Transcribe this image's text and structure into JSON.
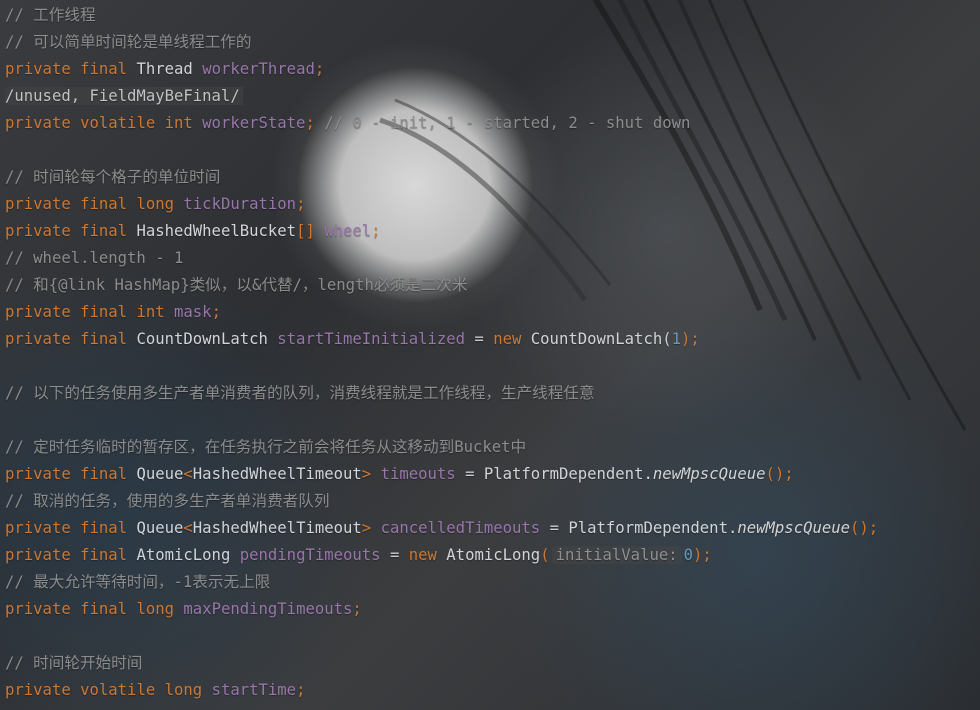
{
  "code_lines": [
    {
      "kind": "line",
      "tokens": [
        {
          "text": "// 工作线程",
          "cls": "cm"
        }
      ]
    },
    {
      "kind": "line",
      "tokens": [
        {
          "text": "// 可以简单时间轮是单线程工作的",
          "cls": "cm"
        }
      ]
    },
    {
      "kind": "line",
      "tokens": [
        {
          "text": "private",
          "cls": "kw"
        },
        {
          "text": " ",
          "cls": "plain"
        },
        {
          "text": "final",
          "cls": "kw"
        },
        {
          "text": " ",
          "cls": "plain"
        },
        {
          "text": "Thread",
          "cls": "ty"
        },
        {
          "text": " ",
          "cls": "plain"
        },
        {
          "text": "workerThread",
          "cls": "fld"
        },
        {
          "text": ";",
          "cls": "kw"
        }
      ]
    },
    {
      "kind": "line",
      "tokens": [
        {
          "text": "/unused, FieldMayBeFinal/",
          "cls": "suppress"
        }
      ]
    },
    {
      "kind": "line",
      "tokens": [
        {
          "text": "private",
          "cls": "kw"
        },
        {
          "text": " ",
          "cls": "plain"
        },
        {
          "text": "volatile",
          "cls": "kw"
        },
        {
          "text": " ",
          "cls": "plain"
        },
        {
          "text": "int",
          "cls": "kw"
        },
        {
          "text": " ",
          "cls": "plain"
        },
        {
          "text": "workerState",
          "cls": "fld"
        },
        {
          "text": "; ",
          "cls": "kw"
        },
        {
          "text": "// 0 - init, 1 - started, 2 - shut down",
          "cls": "cm"
        }
      ]
    },
    {
      "kind": "blank"
    },
    {
      "kind": "line",
      "tokens": [
        {
          "text": "// 时间轮每个格子的单位时间",
          "cls": "cm"
        }
      ]
    },
    {
      "kind": "line",
      "tokens": [
        {
          "text": "private",
          "cls": "kw"
        },
        {
          "text": " ",
          "cls": "plain"
        },
        {
          "text": "final",
          "cls": "kw"
        },
        {
          "text": " ",
          "cls": "plain"
        },
        {
          "text": "long",
          "cls": "kw"
        },
        {
          "text": " ",
          "cls": "plain"
        },
        {
          "text": "tickDuration",
          "cls": "fld"
        },
        {
          "text": ";",
          "cls": "kw"
        }
      ]
    },
    {
      "kind": "line",
      "tokens": [
        {
          "text": "private",
          "cls": "kw"
        },
        {
          "text": " ",
          "cls": "plain"
        },
        {
          "text": "final",
          "cls": "kw"
        },
        {
          "text": " ",
          "cls": "plain"
        },
        {
          "text": "HashedWheelBucket",
          "cls": "ty"
        },
        {
          "text": "[]",
          "cls": "kw"
        },
        {
          "text": " ",
          "cls": "plain"
        },
        {
          "text": "wheel",
          "cls": "fld"
        },
        {
          "text": ";",
          "cls": "kw"
        }
      ]
    },
    {
      "kind": "line",
      "tokens": [
        {
          "text": "// wheel.length - 1",
          "cls": "cm"
        }
      ]
    },
    {
      "kind": "line",
      "tokens": [
        {
          "text": "// 和{@link HashMap}类似，以&代替/，length必须是二次米",
          "cls": "cm"
        }
      ]
    },
    {
      "kind": "line",
      "tokens": [
        {
          "text": "private",
          "cls": "kw"
        },
        {
          "text": " ",
          "cls": "plain"
        },
        {
          "text": "final",
          "cls": "kw"
        },
        {
          "text": " ",
          "cls": "plain"
        },
        {
          "text": "int",
          "cls": "kw"
        },
        {
          "text": " ",
          "cls": "plain"
        },
        {
          "text": "mask",
          "cls": "fld"
        },
        {
          "text": ";",
          "cls": "kw"
        }
      ]
    },
    {
      "kind": "line",
      "tokens": [
        {
          "text": "private",
          "cls": "kw"
        },
        {
          "text": " ",
          "cls": "plain"
        },
        {
          "text": "final",
          "cls": "kw"
        },
        {
          "text": " ",
          "cls": "plain"
        },
        {
          "text": "CountDownLatch",
          "cls": "ty"
        },
        {
          "text": " ",
          "cls": "plain"
        },
        {
          "text": "startTimeInitialized",
          "cls": "fld"
        },
        {
          "text": " = ",
          "cls": "plain"
        },
        {
          "text": "new",
          "cls": "kw"
        },
        {
          "text": " ",
          "cls": "plain"
        },
        {
          "text": "CountDownLatch",
          "cls": "ty"
        },
        {
          "text": "(",
          "cls": "plain"
        },
        {
          "text": "1",
          "cls": "num"
        },
        {
          "text": ");",
          "cls": "kw"
        }
      ]
    },
    {
      "kind": "blank"
    },
    {
      "kind": "line",
      "tokens": [
        {
          "text": "// 以下的任务使用多生产者单消费者的队列，消费线程就是工作线程，生产线程任意",
          "cls": "cm"
        }
      ]
    },
    {
      "kind": "blank"
    },
    {
      "kind": "line",
      "tokens": [
        {
          "text": "// 定时任务临时的暂存区，在任务执行之前会将任务从这移动到Bucket中",
          "cls": "cm"
        }
      ]
    },
    {
      "kind": "line",
      "tokens": [
        {
          "text": "private",
          "cls": "kw"
        },
        {
          "text": " ",
          "cls": "plain"
        },
        {
          "text": "final",
          "cls": "kw"
        },
        {
          "text": " ",
          "cls": "plain"
        },
        {
          "text": "Queue",
          "cls": "ty"
        },
        {
          "text": "<",
          "cls": "kw"
        },
        {
          "text": "HashedWheelTimeout",
          "cls": "ty"
        },
        {
          "text": ">",
          "cls": "kw"
        },
        {
          "text": " ",
          "cls": "plain"
        },
        {
          "text": "timeouts",
          "cls": "fld"
        },
        {
          "text": " = ",
          "cls": "plain"
        },
        {
          "text": "PlatformDependent.",
          "cls": "ty"
        },
        {
          "text": "newMpscQueue",
          "cls": "mth"
        },
        {
          "text": "();",
          "cls": "kw"
        }
      ]
    },
    {
      "kind": "line",
      "tokens": [
        {
          "text": "// 取消的任务，使用的多生产者单消费者队列",
          "cls": "cm"
        }
      ]
    },
    {
      "kind": "line",
      "tokens": [
        {
          "text": "private",
          "cls": "kw"
        },
        {
          "text": " ",
          "cls": "plain"
        },
        {
          "text": "final",
          "cls": "kw"
        },
        {
          "text": " ",
          "cls": "plain"
        },
        {
          "text": "Queue",
          "cls": "ty"
        },
        {
          "text": "<",
          "cls": "kw"
        },
        {
          "text": "HashedWheelTimeout",
          "cls": "ty"
        },
        {
          "text": ">",
          "cls": "kw"
        },
        {
          "text": " ",
          "cls": "plain"
        },
        {
          "text": "cancelledTimeouts",
          "cls": "fld"
        },
        {
          "text": " = ",
          "cls": "plain"
        },
        {
          "text": "PlatformDependent.",
          "cls": "ty"
        },
        {
          "text": "newMpscQueue",
          "cls": "mth"
        },
        {
          "text": "();",
          "cls": "kw"
        }
      ]
    },
    {
      "kind": "line",
      "tokens": [
        {
          "text": "private",
          "cls": "kw"
        },
        {
          "text": " ",
          "cls": "plain"
        },
        {
          "text": "final",
          "cls": "kw"
        },
        {
          "text": " ",
          "cls": "plain"
        },
        {
          "text": "AtomicLong",
          "cls": "ty"
        },
        {
          "text": " ",
          "cls": "plain"
        },
        {
          "text": "pendingTimeouts",
          "cls": "fld"
        },
        {
          "text": " = ",
          "cls": "plain"
        },
        {
          "text": "new",
          "cls": "kw"
        },
        {
          "text": " ",
          "cls": "plain"
        },
        {
          "text": "AtomicLong",
          "cls": "ty"
        },
        {
          "text": "(",
          "cls": "kw"
        },
        {
          "text": "initialValue:",
          "cls": "hint"
        },
        {
          "text": "0",
          "cls": "num"
        },
        {
          "text": ");",
          "cls": "kw"
        }
      ]
    },
    {
      "kind": "line",
      "tokens": [
        {
          "text": "// 最大允许等待时间，-1表示无上限",
          "cls": "cm"
        }
      ]
    },
    {
      "kind": "line",
      "tokens": [
        {
          "text": "private",
          "cls": "kw"
        },
        {
          "text": " ",
          "cls": "plain"
        },
        {
          "text": "final",
          "cls": "kw"
        },
        {
          "text": " ",
          "cls": "plain"
        },
        {
          "text": "long",
          "cls": "kw"
        },
        {
          "text": " ",
          "cls": "plain"
        },
        {
          "text": "maxPendingTimeouts",
          "cls": "fld"
        },
        {
          "text": ";",
          "cls": "kw"
        }
      ]
    },
    {
      "kind": "blank"
    },
    {
      "kind": "line",
      "tokens": [
        {
          "text": "// 时间轮开始时间",
          "cls": "cm"
        }
      ]
    },
    {
      "kind": "line",
      "tokens": [
        {
          "text": "private",
          "cls": "kw"
        },
        {
          "text": " ",
          "cls": "plain"
        },
        {
          "text": "volatile",
          "cls": "kw"
        },
        {
          "text": " ",
          "cls": "plain"
        },
        {
          "text": "long",
          "cls": "kw"
        },
        {
          "text": " ",
          "cls": "plain"
        },
        {
          "text": "startTime",
          "cls": "fld"
        },
        {
          "text": ";",
          "cls": "kw"
        }
      ]
    }
  ]
}
